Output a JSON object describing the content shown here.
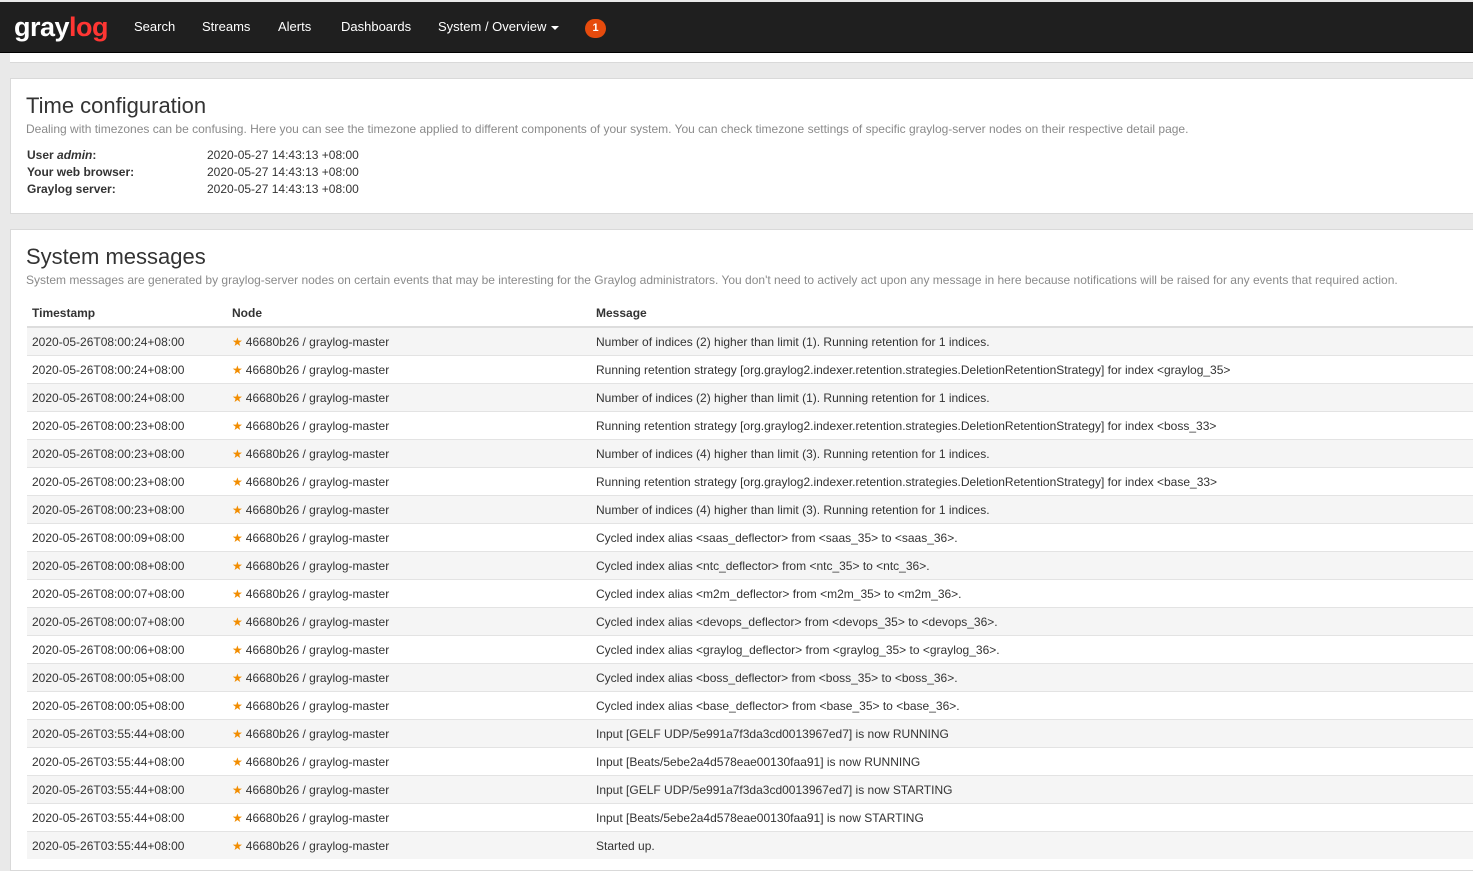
{
  "nav": {
    "logo_pre": "gray",
    "logo_post": "log",
    "items": [
      "Search",
      "Streams",
      "Alerts",
      "Dashboards"
    ],
    "system_dropdown": "System / Overview",
    "notification_count": "1"
  },
  "time_config": {
    "title": "Time configuration",
    "description": "Dealing with timezones can be confusing. Here you can see the timezone applied to different components of your system. You can check timezone settings of specific graylog-server nodes on their respective detail page.",
    "user_label_prefix": "User ",
    "user_name": "admin",
    "user_label_suffix": ":",
    "user_value": "2020-05-27 14:43:13 +08:00",
    "browser_label": "Your web browser:",
    "browser_value": "2020-05-27 14:43:13 +08:00",
    "server_label": "Graylog server:",
    "server_value": "2020-05-27 14:43:13 +08:00"
  },
  "system_messages": {
    "title": "System messages",
    "description": "System messages are generated by graylog-server nodes on certain events that may be interesting for the Graylog administrators. You don't need to actively act upon any message in here because notifications will be raised for any events that required action.",
    "columns": [
      "Timestamp",
      "Node",
      "Message"
    ],
    "rows": [
      {
        "timestamp": "2020-05-26T08:00:24+08:00",
        "node": "46680b26 / graylog-master",
        "message": "Number of indices (2) higher than limit (1). Running retention for 1 indices."
      },
      {
        "timestamp": "2020-05-26T08:00:24+08:00",
        "node": "46680b26 / graylog-master",
        "message": "Running retention strategy [org.graylog2.indexer.retention.strategies.DeletionRetentionStrategy] for index <graylog_35>"
      },
      {
        "timestamp": "2020-05-26T08:00:24+08:00",
        "node": "46680b26 / graylog-master",
        "message": "Number of indices (2) higher than limit (1). Running retention for 1 indices."
      },
      {
        "timestamp": "2020-05-26T08:00:23+08:00",
        "node": "46680b26 / graylog-master",
        "message": "Running retention strategy [org.graylog2.indexer.retention.strategies.DeletionRetentionStrategy] for index <boss_33>"
      },
      {
        "timestamp": "2020-05-26T08:00:23+08:00",
        "node": "46680b26 / graylog-master",
        "message": "Number of indices (4) higher than limit (3). Running retention for 1 indices."
      },
      {
        "timestamp": "2020-05-26T08:00:23+08:00",
        "node": "46680b26 / graylog-master",
        "message": "Running retention strategy [org.graylog2.indexer.retention.strategies.DeletionRetentionStrategy] for index <base_33>"
      },
      {
        "timestamp": "2020-05-26T08:00:23+08:00",
        "node": "46680b26 / graylog-master",
        "message": "Number of indices (4) higher than limit (3). Running retention for 1 indices."
      },
      {
        "timestamp": "2020-05-26T08:00:09+08:00",
        "node": "46680b26 / graylog-master",
        "message": "Cycled index alias <saas_deflector> from <saas_35> to <saas_36>."
      },
      {
        "timestamp": "2020-05-26T08:00:08+08:00",
        "node": "46680b26 / graylog-master",
        "message": "Cycled index alias <ntc_deflector> from <ntc_35> to <ntc_36>."
      },
      {
        "timestamp": "2020-05-26T08:00:07+08:00",
        "node": "46680b26 / graylog-master",
        "message": "Cycled index alias <m2m_deflector> from <m2m_35> to <m2m_36>."
      },
      {
        "timestamp": "2020-05-26T08:00:07+08:00",
        "node": "46680b26 / graylog-master",
        "message": "Cycled index alias <devops_deflector> from <devops_35> to <devops_36>."
      },
      {
        "timestamp": "2020-05-26T08:00:06+08:00",
        "node": "46680b26 / graylog-master",
        "message": "Cycled index alias <graylog_deflector> from <graylog_35> to <graylog_36>."
      },
      {
        "timestamp": "2020-05-26T08:00:05+08:00",
        "node": "46680b26 / graylog-master",
        "message": "Cycled index alias <boss_deflector> from <boss_35> to <boss_36>."
      },
      {
        "timestamp": "2020-05-26T08:00:05+08:00",
        "node": "46680b26 / graylog-master",
        "message": "Cycled index alias <base_deflector> from <base_35> to <base_36>."
      },
      {
        "timestamp": "2020-05-26T03:55:44+08:00",
        "node": "46680b26 / graylog-master",
        "message": "Input [GELF UDP/5e991a7f3da3cd0013967ed7] is now RUNNING"
      },
      {
        "timestamp": "2020-05-26T03:55:44+08:00",
        "node": "46680b26 / graylog-master",
        "message": "Input [Beats/5ebe2a4d578eae00130faa91] is now RUNNING"
      },
      {
        "timestamp": "2020-05-26T03:55:44+08:00",
        "node": "46680b26 / graylog-master",
        "message": "Input [GELF UDP/5e991a7f3da3cd0013967ed7] is now STARTING"
      },
      {
        "timestamp": "2020-05-26T03:55:44+08:00",
        "node": "46680b26 / graylog-master",
        "message": "Input [Beats/5ebe2a4d578eae00130faa91] is now STARTING"
      },
      {
        "timestamp": "2020-05-26T03:55:44+08:00",
        "node": "46680b26 / graylog-master",
        "message": "Started up."
      }
    ]
  },
  "colors": {
    "navbar": "#1f1f1f",
    "logo_accent": "#ff3633",
    "badge": "#e64b0d",
    "star": "#f28d00"
  },
  "icons": {
    "master_node": "star-icon",
    "dropdown": "caret-down-icon"
  }
}
